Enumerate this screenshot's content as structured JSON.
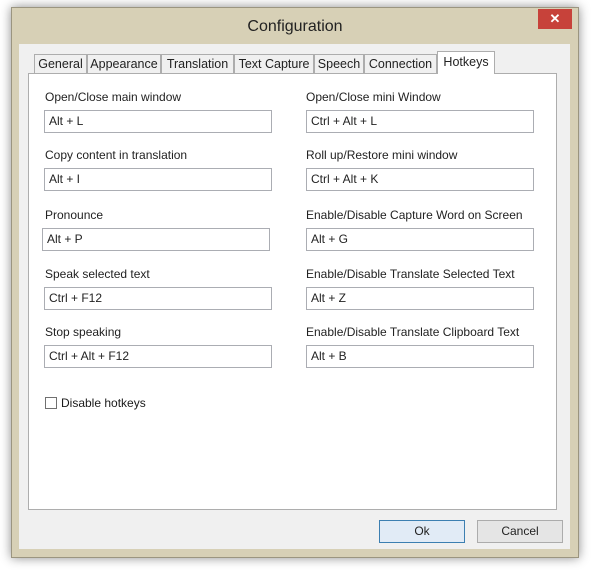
{
  "window": {
    "title": "Configuration",
    "close_glyph": "✕"
  },
  "tabs": [
    {
      "label": "General"
    },
    {
      "label": "Appearance"
    },
    {
      "label": "Translation"
    },
    {
      "label": "Text Capture"
    },
    {
      "label": "Speech"
    },
    {
      "label": "Connection"
    },
    {
      "label": "Hotkeys",
      "active": true
    }
  ],
  "left_hotkeys": [
    {
      "label": "Open/Close main window",
      "value": "Alt + L"
    },
    {
      "label": "Copy content in translation",
      "value": "Alt + I"
    },
    {
      "label": "Pronounce",
      "value": "Alt + P"
    },
    {
      "label": "Speak selected text",
      "value": "Ctrl + F12"
    },
    {
      "label": "Stop speaking",
      "value": "Ctrl + Alt + F12"
    }
  ],
  "right_hotkeys": [
    {
      "label": "Open/Close mini Window",
      "value": "Ctrl + Alt + L"
    },
    {
      "label": "Roll up/Restore mini window",
      "value": "Ctrl + Alt + K"
    },
    {
      "label": "Enable/Disable Capture Word on Screen",
      "value": "Alt + G"
    },
    {
      "label": "Enable/Disable Translate Selected Text",
      "value": "Alt + Z"
    },
    {
      "label": "Enable/Disable Translate Clipboard Text",
      "value": "Alt + B"
    }
  ],
  "disable_hotkeys": {
    "label": "Disable hotkeys",
    "checked": false
  },
  "buttons": {
    "ok": "Ok",
    "cancel": "Cancel"
  },
  "colors": {
    "frame": "#d7d0b6",
    "close": "#c7423a",
    "ok_border": "#3c7fb1"
  }
}
